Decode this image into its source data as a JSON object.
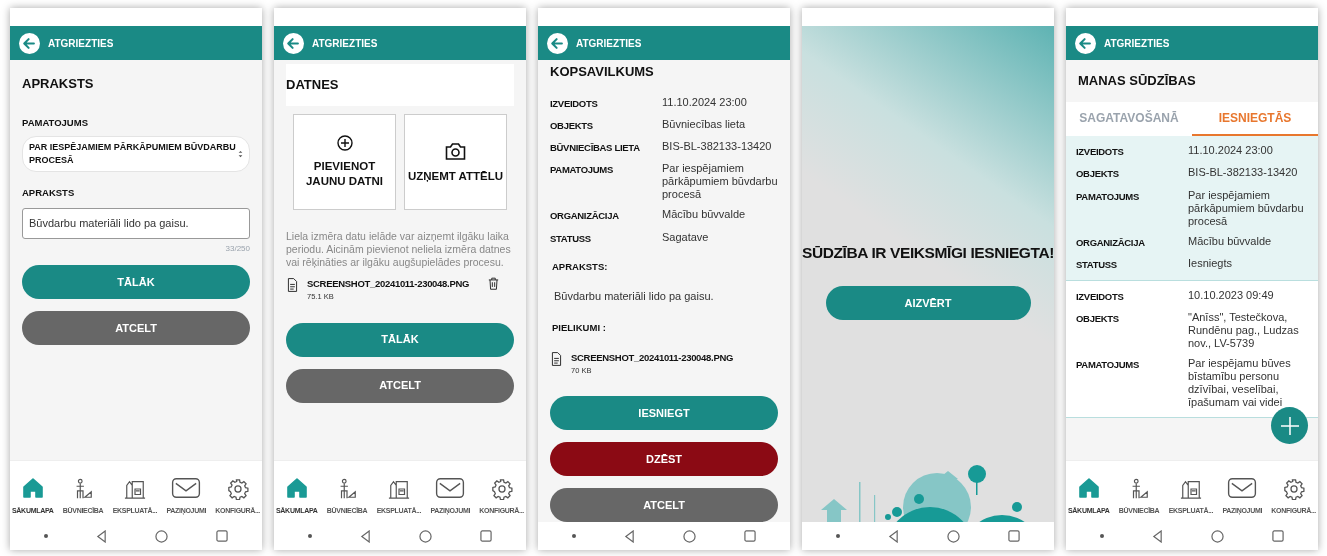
{
  "screens": [
    {
      "kind": "description_form",
      "back_label": "ATGRIEZTIES",
      "title": "APRAKSTS",
      "select_label": "PAMATOJUMS",
      "select_value": "PAR IESPĒJAMIEM PĀRKĀPUMIEM BŪVDARBU PROCESĀ",
      "text_label": "APRAKSTS",
      "text_value": "Būvdarbu materiāli lido pa gaisu.",
      "counter": "33/250",
      "buttons": [
        {
          "label": "TĀLĀK",
          "kind": "primary"
        },
        {
          "label": "ATCELT",
          "kind": "secondary"
        }
      ],
      "nav": [
        {
          "label": "SĀKUMLAPA",
          "selected": true
        },
        {
          "label": "BŪVNIECĪBA",
          "selected": false
        },
        {
          "label": "EKSPLUATĀ...",
          "selected": false
        },
        {
          "label": "PAZIŅOJUMI",
          "selected": false
        },
        {
          "label": "KONFIGURĀ...",
          "selected": false
        }
      ]
    },
    {
      "kind": "files",
      "back_label": "ATGRIEZTIES",
      "title": "DATNES",
      "actions": [
        {
          "label": "PIEVIENOT JAUNU DATNI",
          "kind": "add"
        },
        {
          "label": "UZŅEMT ATTĒLU",
          "kind": "camera"
        }
      ],
      "note": "Liela izmēra datu ielāde var aizņemt ilgāku laika periodu. Aicinām pievienot neliela izmēra datnes vai rēķināties ar ilgāku augšupielādes procesu.",
      "files": [
        {
          "name": "SCREENSHOT_20241011-230048.PNG",
          "size": "75.1 KB",
          "deletable": true
        }
      ],
      "buttons": [
        {
          "label": "TĀLĀK",
          "kind": "primary"
        },
        {
          "label": "ATCELT",
          "kind": "secondary"
        }
      ],
      "nav": [
        {
          "label": "SĀKUMLAPA",
          "selected": true
        },
        {
          "label": "BŪVNIECĪBA",
          "selected": false
        },
        {
          "label": "EKSPLUATĀ...",
          "selected": false
        },
        {
          "label": "PAZIŅOJUMI",
          "selected": false
        },
        {
          "label": "KONFIGURĀ...",
          "selected": false
        }
      ]
    },
    {
      "kind": "summary",
      "back_label": "ATGRIEZTIES",
      "title": "KOPSAVILKUMS",
      "rows": [
        {
          "label": "IZVEIDOTS",
          "value": "11.10.2024 23:00"
        },
        {
          "label": "OBJEKTS",
          "value": "Būvniecības lieta"
        },
        {
          "label": "BŪVNIECĪBAS LIETA",
          "value": "BIS-BL-382133-13420"
        },
        {
          "label": "PAMATOJUMS",
          "value": "Par iespējamiem pārkāpumiem būvdarbu procesā"
        },
        {
          "label": "ORGANIZĀCIJA",
          "value": "Mācību būvvalde"
        },
        {
          "label": "STATUSS",
          "value": "Sagatave"
        }
      ],
      "description_label": "APRAKSTS:",
      "description": "Būvdarbu materiāli lido pa gaisu.",
      "attachments_label": "PIELIKUMI :",
      "files": [
        {
          "name": "SCREENSHOT_20241011-230048.PNG",
          "size": "70 KB",
          "deletable": false
        }
      ],
      "buttons": [
        {
          "label": "IESNIEGT",
          "kind": "primary"
        },
        {
          "label": "DZĒST",
          "kind": "danger"
        },
        {
          "label": "ATCELT",
          "kind": "secondary"
        }
      ]
    },
    {
      "kind": "success",
      "message": "SŪDZĪBA IR VEIKSMĪGI IESNIEGTA!",
      "buttons": [
        {
          "label": "AIZVĒRT",
          "kind": "primary"
        }
      ]
    },
    {
      "kind": "list",
      "back_label": "ATGRIEZTIES",
      "title": "MANAS SŪDZĪBAS",
      "tabs": [
        {
          "label": "SAGATAVOŠANĀ",
          "selected": false
        },
        {
          "label": "IESNIEGTĀS",
          "selected": true
        }
      ],
      "cards": [
        {
          "highlighted": true,
          "rows": [
            {
              "label": "IZVEIDOTS",
              "value": "11.10.2024 23:00"
            },
            {
              "label": "OBJEKTS",
              "value": "BIS-BL-382133-13420"
            },
            {
              "label": "PAMATOJUMS",
              "value": "Par iespējamiem pārkāpumiem būvdarbu procesā"
            },
            {
              "label": "ORGANIZĀCIJA",
              "value": "Mācību būvvalde"
            },
            {
              "label": "STATUSS",
              "value": "Iesniegts"
            }
          ]
        },
        {
          "highlighted": false,
          "rows": [
            {
              "label": "IZVEIDOTS",
              "value": "10.10.2023 09:49"
            },
            {
              "label": "OBJEKTS",
              "value": "\"Anīss\", Testečkova, Rundēnu pag., Ludzas nov., LV-5739"
            },
            {
              "label": "PAMATOJUMS",
              "value": "Par iespējamu būves bīstamību personu dzīvībai, veselībai, īpašumam vai videi"
            }
          ]
        }
      ],
      "nav": [
        {
          "label": "SĀKUMLAPA",
          "selected": true
        },
        {
          "label": "BŪVNIECĪBA",
          "selected": false
        },
        {
          "label": "EKSPLUATĀ...",
          "selected": false
        },
        {
          "label": "PAZIŅOJUMI",
          "selected": false
        },
        {
          "label": "KONFIGURĀ...",
          "selected": false
        }
      ]
    }
  ]
}
